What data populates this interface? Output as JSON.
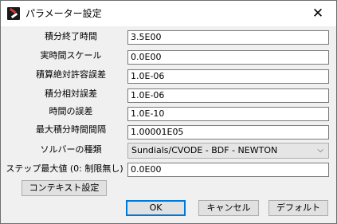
{
  "window": {
    "title": "パラメーター設定",
    "close_glyph": "✕",
    "icon": "app-icon"
  },
  "params": [
    {
      "label": "積分終了時間",
      "value": "3.5E00"
    },
    {
      "label": "実時間スケール",
      "value": "0.0E00"
    },
    {
      "label": "積算絶対許容誤差",
      "value": "1.0E-06"
    },
    {
      "label": "積分相対誤差",
      "value": "1.0E-06"
    },
    {
      "label": "時間の誤差",
      "value": "1.0E-10"
    },
    {
      "label": "最大積分時間間隔",
      "value": "1.00001E05"
    }
  ],
  "solver": {
    "label": "ソルバーの種類",
    "selected": "Sundials/CVODE - BDF - NEWTON",
    "chevron": "⌵"
  },
  "max_steps": {
    "label": "ステップ最大値 (0: 制限無し)",
    "value": "0.0E00"
  },
  "buttons": {
    "context": "コンテキスト設定",
    "ok": "OK",
    "cancel": "キャンセル",
    "default": "デフォルト"
  }
}
